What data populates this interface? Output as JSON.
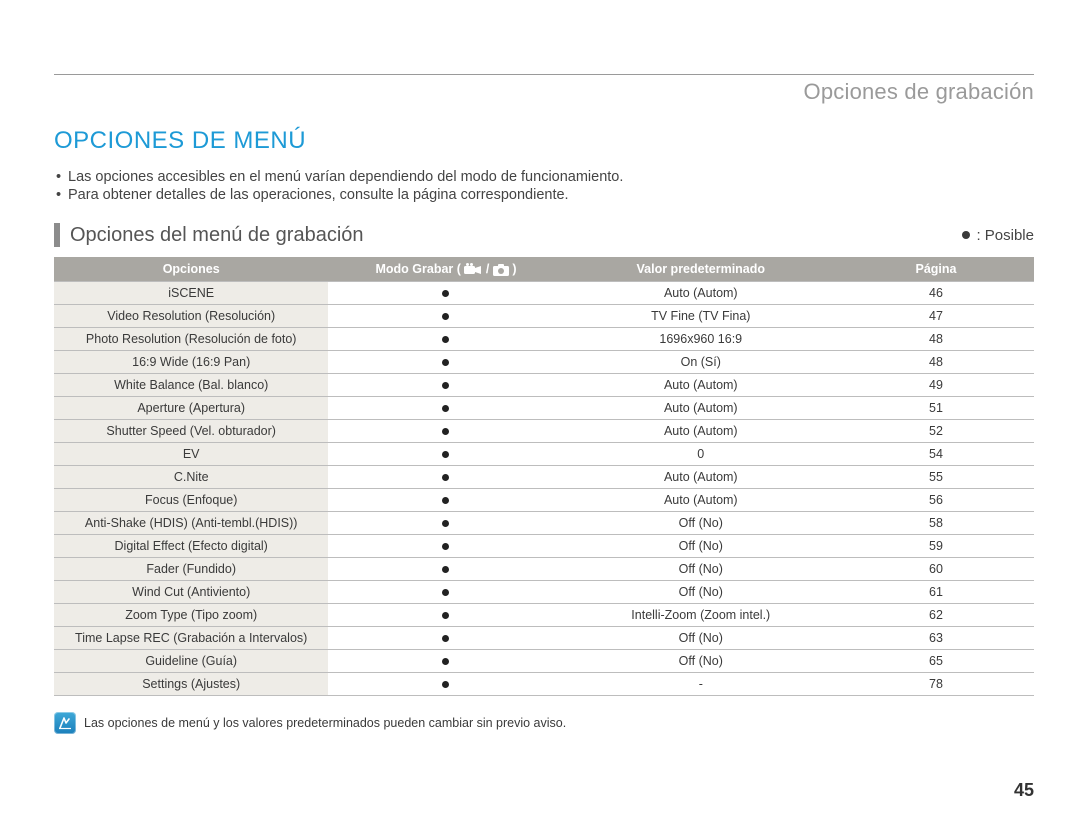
{
  "header": {
    "section_label": "Opciones de grabación",
    "title": "OPCIONES DE MENÚ"
  },
  "notes": [
    "Las opciones accesibles en el menú varían dependiendo del modo de funcionamiento.",
    "Para obtener detalles de las operaciones, consulte la página correspondiente."
  ],
  "subhead": "Opciones del menú de grabación",
  "legend_label": ": Posible",
  "table": {
    "columns": {
      "options": "Opciones",
      "mode_prefix": "Modo Grabar (",
      "mode_suffix": ")",
      "default": "Valor predeterminado",
      "page": "Página"
    },
    "rows": [
      {
        "option": "iSCENE",
        "mode": true,
        "default": "Auto (Autom)",
        "page": "46"
      },
      {
        "option": "Video Resolution (Resolución)",
        "mode": true,
        "default": "TV Fine (TV Fina)",
        "page": "47"
      },
      {
        "option": "Photo Resolution (Resolución de foto)",
        "mode": true,
        "default": "1696x960 16:9",
        "page": "48"
      },
      {
        "option": "16:9 Wide (16:9 Pan)",
        "mode": true,
        "default": "On (Sí)",
        "page": "48"
      },
      {
        "option": "White Balance (Bal. blanco)",
        "mode": true,
        "default": "Auto (Autom)",
        "page": "49"
      },
      {
        "option": "Aperture (Apertura)",
        "mode": true,
        "default": "Auto (Autom)",
        "page": "51"
      },
      {
        "option": "Shutter Speed (Vel. obturador)",
        "mode": true,
        "default": "Auto (Autom)",
        "page": "52"
      },
      {
        "option": "EV",
        "mode": true,
        "default": "0",
        "page": "54"
      },
      {
        "option": "C.Nite",
        "mode": true,
        "default": "Auto (Autom)",
        "page": "55"
      },
      {
        "option": "Focus (Enfoque)",
        "mode": true,
        "default": "Auto (Autom)",
        "page": "56"
      },
      {
        "option": "Anti-Shake (HDIS) (Anti-tembl.(HDIS))",
        "mode": true,
        "default": "Off (No)",
        "page": "58"
      },
      {
        "option": "Digital Effect (Efecto digital)",
        "mode": true,
        "default": "Off (No)",
        "page": "59"
      },
      {
        "option": "Fader (Fundido)",
        "mode": true,
        "default": "Off (No)",
        "page": "60"
      },
      {
        "option": "Wind Cut (Antiviento)",
        "mode": true,
        "default": "Off (No)",
        "page": "61"
      },
      {
        "option": "Zoom Type (Tipo zoom)",
        "mode": true,
        "default": "Intelli-Zoom (Zoom intel.)",
        "page": "62"
      },
      {
        "option": "Time Lapse REC (Grabación a Intervalos)",
        "mode": true,
        "default": "Off (No)",
        "page": "63"
      },
      {
        "option": "Guideline (Guía)",
        "mode": true,
        "default": "Off (No)",
        "page": "65"
      },
      {
        "option": "Settings (Ajustes)",
        "mode": true,
        "default": "-",
        "page": "78"
      }
    ]
  },
  "footnote": "Las opciones de menú y los valores predeterminados pueden cambiar sin previo aviso.",
  "page_number": "45"
}
